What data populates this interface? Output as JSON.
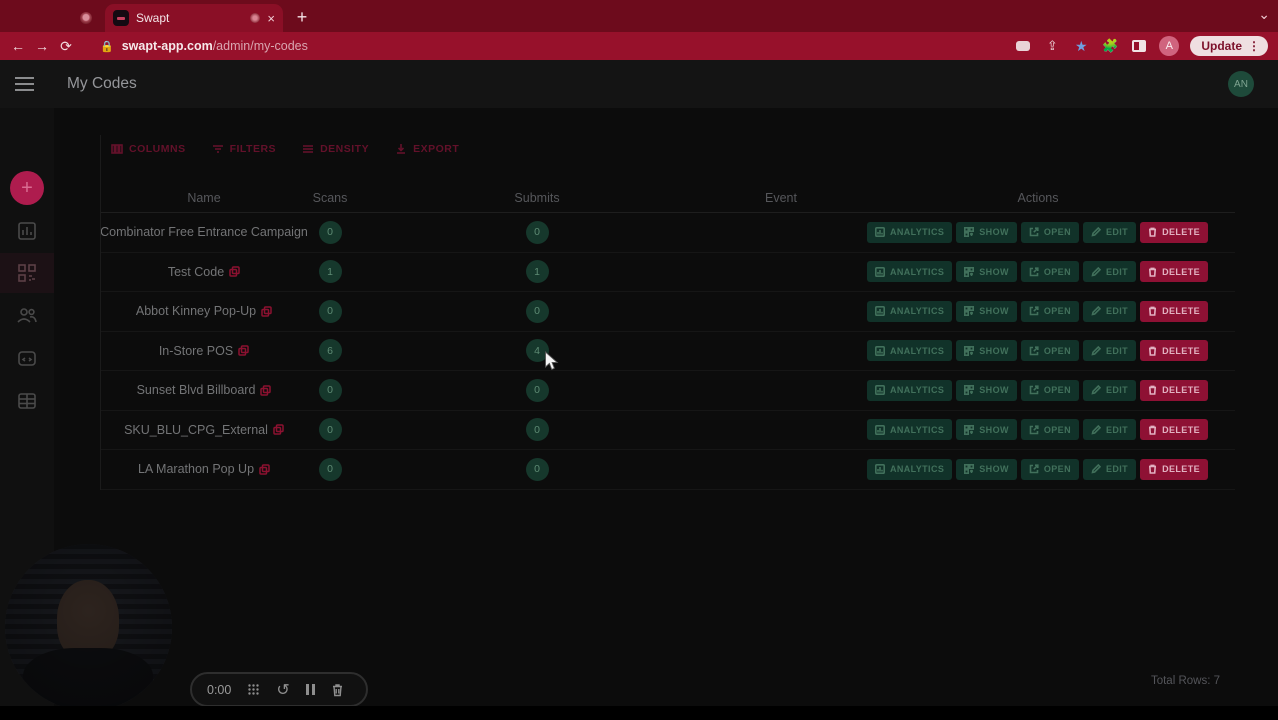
{
  "browser": {
    "tab_title": "Swapt",
    "close_glyph": "×",
    "new_tab_glyph": "+",
    "chevron_glyph": "⌄",
    "back_glyph": "←",
    "forward_glyph": "→",
    "reload_glyph": "⟳",
    "lock_glyph": "🔒",
    "url_domain": "swapt-app.com",
    "url_path": "/admin/my-codes",
    "star_glyph": "★",
    "puzzle_glyph": "🧩",
    "share_glyph": "⇪",
    "avatar_initial": "A",
    "update_label": "Update",
    "kebab_glyph": "⋮"
  },
  "app": {
    "header": {
      "title": "My Codes",
      "avatar_initials": "AN"
    },
    "fab_glyph": "+",
    "grid_toolbar": {
      "columns": "COLUMNS",
      "filters": "FILTERS",
      "density": "DENSITY",
      "export": "EXPORT"
    },
    "table": {
      "columns": [
        "Name",
        "Scans",
        "Submits",
        "Event",
        "Actions"
      ],
      "actions": [
        "ANALYTICS",
        "SHOW",
        "OPEN",
        "EDIT",
        "DELETE"
      ],
      "rows": [
        {
          "name": "Combinator Free Entrance Campaign",
          "name_icon": false,
          "scans": "0",
          "submits": "0",
          "event": ""
        },
        {
          "name": "Test Code",
          "name_icon": true,
          "scans": "1",
          "submits": "1",
          "event": ""
        },
        {
          "name": "Abbot Kinney Pop-Up",
          "name_icon": true,
          "scans": "0",
          "submits": "0",
          "event": ""
        },
        {
          "name": "In-Store POS",
          "name_icon": true,
          "scans": "6",
          "submits": "4",
          "event": ""
        },
        {
          "name": "Sunset Blvd Billboard",
          "name_icon": true,
          "scans": "0",
          "submits": "0",
          "event": ""
        },
        {
          "name": "SKU_BLU_CPG_External",
          "name_icon": true,
          "scans": "0",
          "submits": "0",
          "event": ""
        },
        {
          "name": "LA Marathon Pop Up",
          "name_icon": true,
          "scans": "0",
          "submits": "0",
          "event": ""
        }
      ],
      "total_rows_label": "Total Rows: 7"
    }
  },
  "recorder": {
    "time": "0:00",
    "undo_glyph": "↺"
  },
  "colors": {
    "browser_theme": "#97112b",
    "accent_pink": "#ae1c4e",
    "badge_green": "#16382c",
    "action_green": "#113229",
    "delete_red": "#8e1134"
  }
}
